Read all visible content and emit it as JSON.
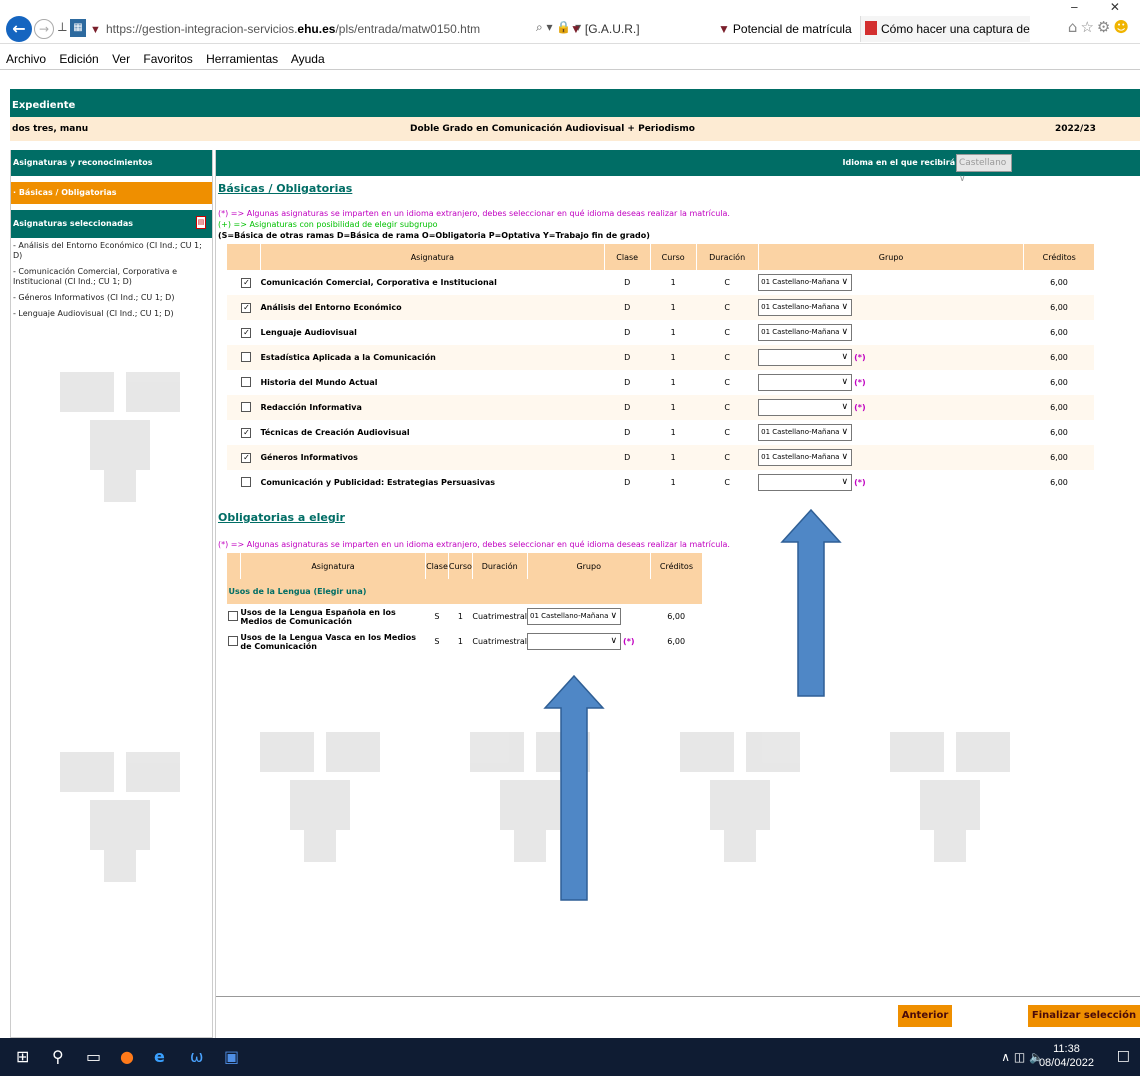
{
  "browser": {
    "url_prefix": "https://gestion-integracion-servicios.",
    "url_domain": "ehu.es",
    "url_path": "/pls/entrada/matw0150.htm",
    "search_tools": "⌕ ▾ 🔒 ▾",
    "tabs": [
      {
        "label": "[G.A.U.R.]"
      },
      {
        "label": "Potencial de matrícula",
        "close": "×"
      },
      {
        "label": "Cómo hacer una captura de pa..."
      }
    ],
    "window_controls": "‒ ✕"
  },
  "menu": [
    "Archivo",
    "Edición",
    "Ver",
    "Favoritos",
    "Herramientas",
    "Ayuda"
  ],
  "header": {
    "title": "Expediente",
    "student": "dos tres, manu",
    "degree": "Doble Grado en Comunicación Audiovisual + Periodismo",
    "year": "2022/23"
  },
  "sidebar": {
    "heading": "Asignaturas y reconocimientos",
    "active": "· Básicas / Obligatorias",
    "selected_heading": "Asignaturas seleccionadas",
    "items": [
      "- Análisis del Entorno Económico (CI Ind.; CU 1; D)",
      "- Comunicación Comercial, Corporativa e Institucional (CI Ind.; CU 1; D)",
      "- Géneros Informativos (CI Ind.; CU 1; D)",
      "- Lenguaje Audiovisual (CI Ind.; CU 1; D)"
    ]
  },
  "language": {
    "label": "Idioma en el que recibirá la docencia:",
    "value": "Castellano"
  },
  "basicas": {
    "title": "Básicas / Obligatorias",
    "note_lang": "(*) => Algunas asignaturas se imparten en un idioma extranjero, debes seleccionar en qué idioma deseas realizar la matrícula.",
    "note_subgroup": "(+) => Asignaturas con posibilidad de elegir subgrupo",
    "legend": "(S=Básica de otras ramas D=Básica de rama O=Obligatoria P=Optativa Y=Trabajo fin de grado)",
    "headers": [
      "Asignatura",
      "Clase",
      "Curso",
      "Duración",
      "Grupo",
      "Créditos"
    ],
    "rows": [
      {
        "checked": "✓",
        "name": "Comunicación Comercial, Corporativa e Institucional",
        "clase": "D",
        "curso": "1",
        "duracion": "C",
        "grupo": "01 Castellano-Mañana",
        "ast": "",
        "creditos": "6,00"
      },
      {
        "checked": "✓",
        "name": "Análisis del Entorno Económico",
        "clase": "D",
        "curso": "1",
        "duracion": "C",
        "grupo": "01 Castellano-Mañana",
        "ast": "",
        "creditos": "6,00"
      },
      {
        "checked": "✓",
        "name": "Lenguaje Audiovisual",
        "clase": "D",
        "curso": "1",
        "duracion": "C",
        "grupo": "01 Castellano-Mañana",
        "ast": "",
        "creditos": "6,00"
      },
      {
        "checked": "",
        "name": "Estadística Aplicada a la Comunicación",
        "clase": "D",
        "curso": "1",
        "duracion": "C",
        "grupo": "",
        "ast": "(*)",
        "creditos": "6,00"
      },
      {
        "checked": "",
        "name": "Historia del Mundo Actual",
        "clase": "D",
        "curso": "1",
        "duracion": "C",
        "grupo": "",
        "ast": "(*)",
        "creditos": "6,00"
      },
      {
        "checked": "",
        "name": "Redacción Informativa",
        "clase": "D",
        "curso": "1",
        "duracion": "C",
        "grupo": "",
        "ast": "(*)",
        "creditos": "6,00"
      },
      {
        "checked": "✓",
        "name": "Técnicas de Creación Audiovisual",
        "clase": "D",
        "curso": "1",
        "duracion": "C",
        "grupo": "01 Castellano-Mañana",
        "ast": "",
        "creditos": "6,00"
      },
      {
        "checked": "✓",
        "name": "Géneros Informativos",
        "clase": "D",
        "curso": "1",
        "duracion": "C",
        "grupo": "01 Castellano-Mañana",
        "ast": "",
        "creditos": "6,00"
      },
      {
        "checked": "",
        "name": "Comunicación y Publicidad: Estrategias Persuasivas",
        "clase": "D",
        "curso": "1",
        "duracion": "C",
        "grupo": "",
        "ast": "(*)",
        "creditos": "6,00"
      }
    ]
  },
  "obligatorias": {
    "title": "Obligatorias a elegir",
    "note_lang": "(*) => Algunas asignaturas se imparten en un idioma extranjero, debes seleccionar en qué idioma deseas realizar la matrícula.",
    "headers": [
      "Asignatura",
      "Clase",
      "Curso",
      "Duración",
      "Grupo",
      "Créditos"
    ],
    "group_label": "Usos de la Lengua (Elegir una)",
    "rows": [
      {
        "checked": "",
        "name": "Usos de la Lengua Española en los Medios de Comunicación",
        "clase": "S",
        "curso": "1",
        "duracion": "Cuatrimestral",
        "grupo": "01 Castellano-Mañana",
        "ast": "",
        "creditos": "6,00"
      },
      {
        "checked": "",
        "name": "Usos de la Lengua Vasca en los Medios de Comunicación",
        "clase": "S",
        "curso": "1",
        "duracion": "Cuatrimestral",
        "grupo": "",
        "ast": "(*)",
        "creditos": "6,00"
      }
    ]
  },
  "buttons": {
    "prev": "Anterior",
    "finish": "Finalizar selección"
  },
  "taskbar": {
    "time": "11:38",
    "date": "08/04/2022"
  },
  "colors": {
    "teal": "#006d65",
    "orange": "#ef8f00",
    "header_bg": "#fbd3a4",
    "arrow": "#4f87c6"
  }
}
